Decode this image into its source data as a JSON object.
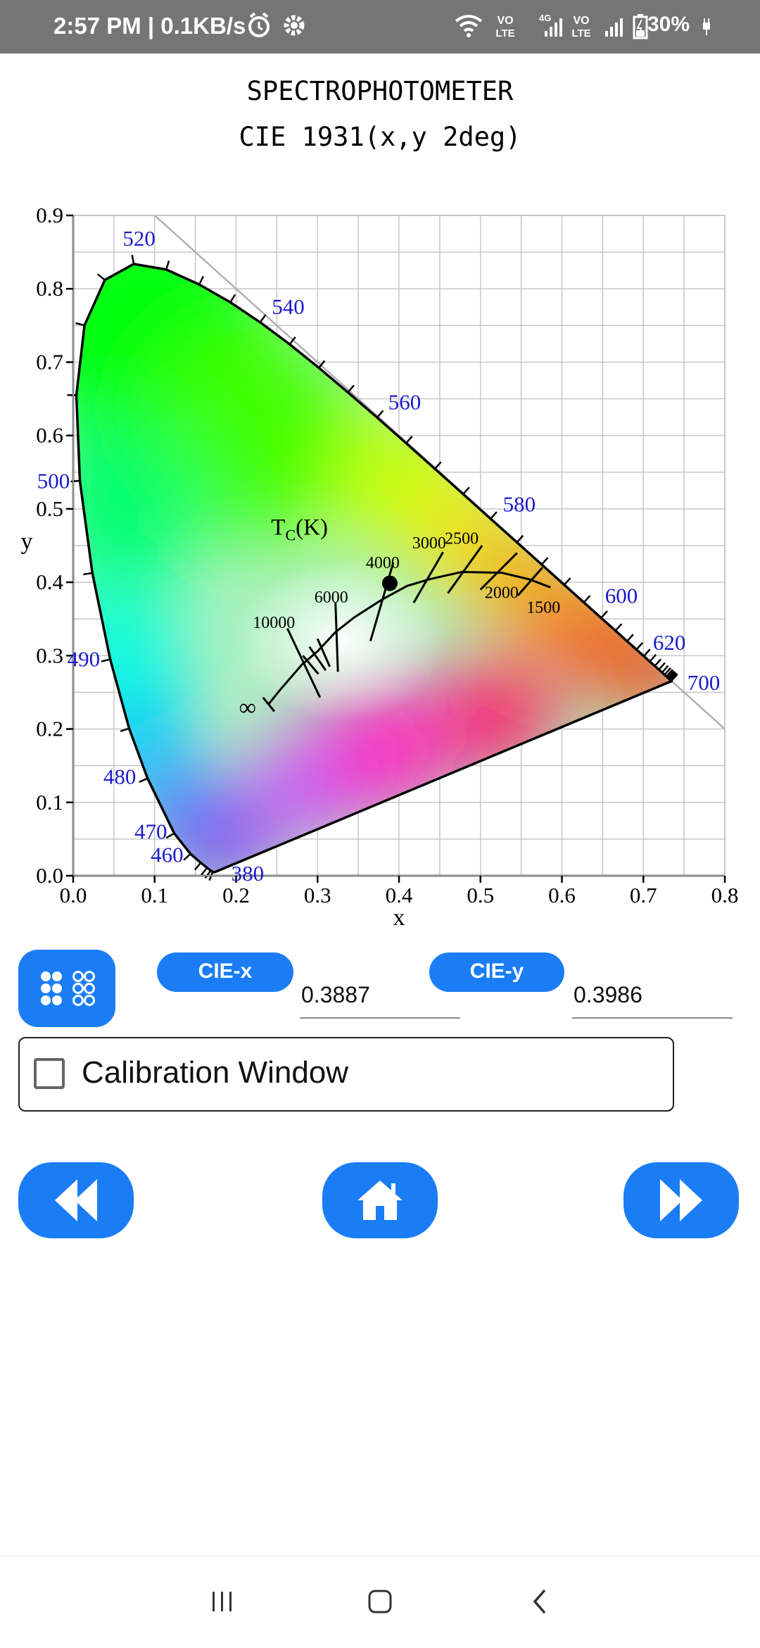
{
  "status_bar": {
    "time": "2:57 PM | 0.1KB/s",
    "battery": "30%",
    "icons": [
      "alarm-icon",
      "gear-icon",
      "wifi-icon",
      "volte-icon",
      "signal-4g-icon",
      "volte-icon",
      "signal-icon",
      "battery-charging-icon"
    ]
  },
  "header": {
    "title": "SPECTROPHOTOMETER",
    "subtitle": "CIE 1931(x,y 2deg)"
  },
  "chart_data": {
    "type": "scatter",
    "xlabel": "x",
    "ylabel": "y",
    "xlim": [
      0.0,
      0.8
    ],
    "ylim": [
      0.0,
      0.9
    ],
    "x_ticks": [
      "0.0",
      "0.1",
      "0.2",
      "0.3",
      "0.4",
      "0.5",
      "0.6",
      "0.7",
      "0.8"
    ],
    "y_ticks": [
      "0.0",
      "0.1",
      "0.2",
      "0.3",
      "0.4",
      "0.5",
      "0.6",
      "0.7",
      "0.8",
      "0.9"
    ],
    "grid": true,
    "wavelength_labels": [
      {
        "text": "380",
        "x": 0.175,
        "y": 0.005
      },
      {
        "text": "460",
        "x": 0.144,
        "y": 0.03
      },
      {
        "text": "470",
        "x": 0.124,
        "y": 0.058
      },
      {
        "text": "480",
        "x": 0.091,
        "y": 0.133
      },
      {
        "text": "490",
        "x": 0.045,
        "y": 0.295
      },
      {
        "text": "500",
        "x": 0.008,
        "y": 0.538
      },
      {
        "text": "520",
        "x": 0.074,
        "y": 0.834
      },
      {
        "text": "540",
        "x": 0.23,
        "y": 0.754
      },
      {
        "text": "560",
        "x": 0.373,
        "y": 0.624
      },
      {
        "text": "580",
        "x": 0.512,
        "y": 0.487
      },
      {
        "text": "600",
        "x": 0.627,
        "y": 0.372
      },
      {
        "text": "620",
        "x": 0.691,
        "y": 0.308
      },
      {
        "text": "700",
        "x": 0.735,
        "y": 0.265
      }
    ],
    "planckian_label": "Tc(K)",
    "cct_labels": [
      {
        "text": "10000",
        "x": 0.281,
        "y": 0.288
      },
      {
        "text": "6000",
        "x": 0.322,
        "y": 0.332
      },
      {
        "text": "4000",
        "x": 0.38,
        "y": 0.377
      },
      {
        "text": "3000",
        "x": 0.437,
        "y": 0.404
      },
      {
        "text": "2500",
        "x": 0.477,
        "y": 0.414
      },
      {
        "text": "2000",
        "x": 0.526,
        "y": 0.413
      },
      {
        "text": "1500",
        "x": 0.586,
        "y": 0.393
      },
      {
        "text": "∞",
        "x": 0.24,
        "y": 0.234
      }
    ],
    "measured_point": {
      "x": 0.3887,
      "y": 0.3986
    }
  },
  "controls": {
    "grid_button_icon": "grid-dots-icon",
    "cie_x_label": "CIE-x",
    "cie_x_value": "0.3887",
    "cie_y_label": "CIE-y",
    "cie_y_value": "0.3986",
    "calibration_label": "Calibration Window",
    "calibration_checked": false
  },
  "nav": {
    "back_icon": "rewind-icon",
    "home_icon": "home-icon",
    "forward_icon": "fast-forward-icon"
  },
  "system_nav": {
    "icons": [
      "recent-apps-icon",
      "home-circle-icon",
      "back-chevron-icon"
    ]
  },
  "colors": {
    "accent": "#1a7df5",
    "status_bar": "#757575",
    "wavelength_label": "#1a1acc"
  }
}
